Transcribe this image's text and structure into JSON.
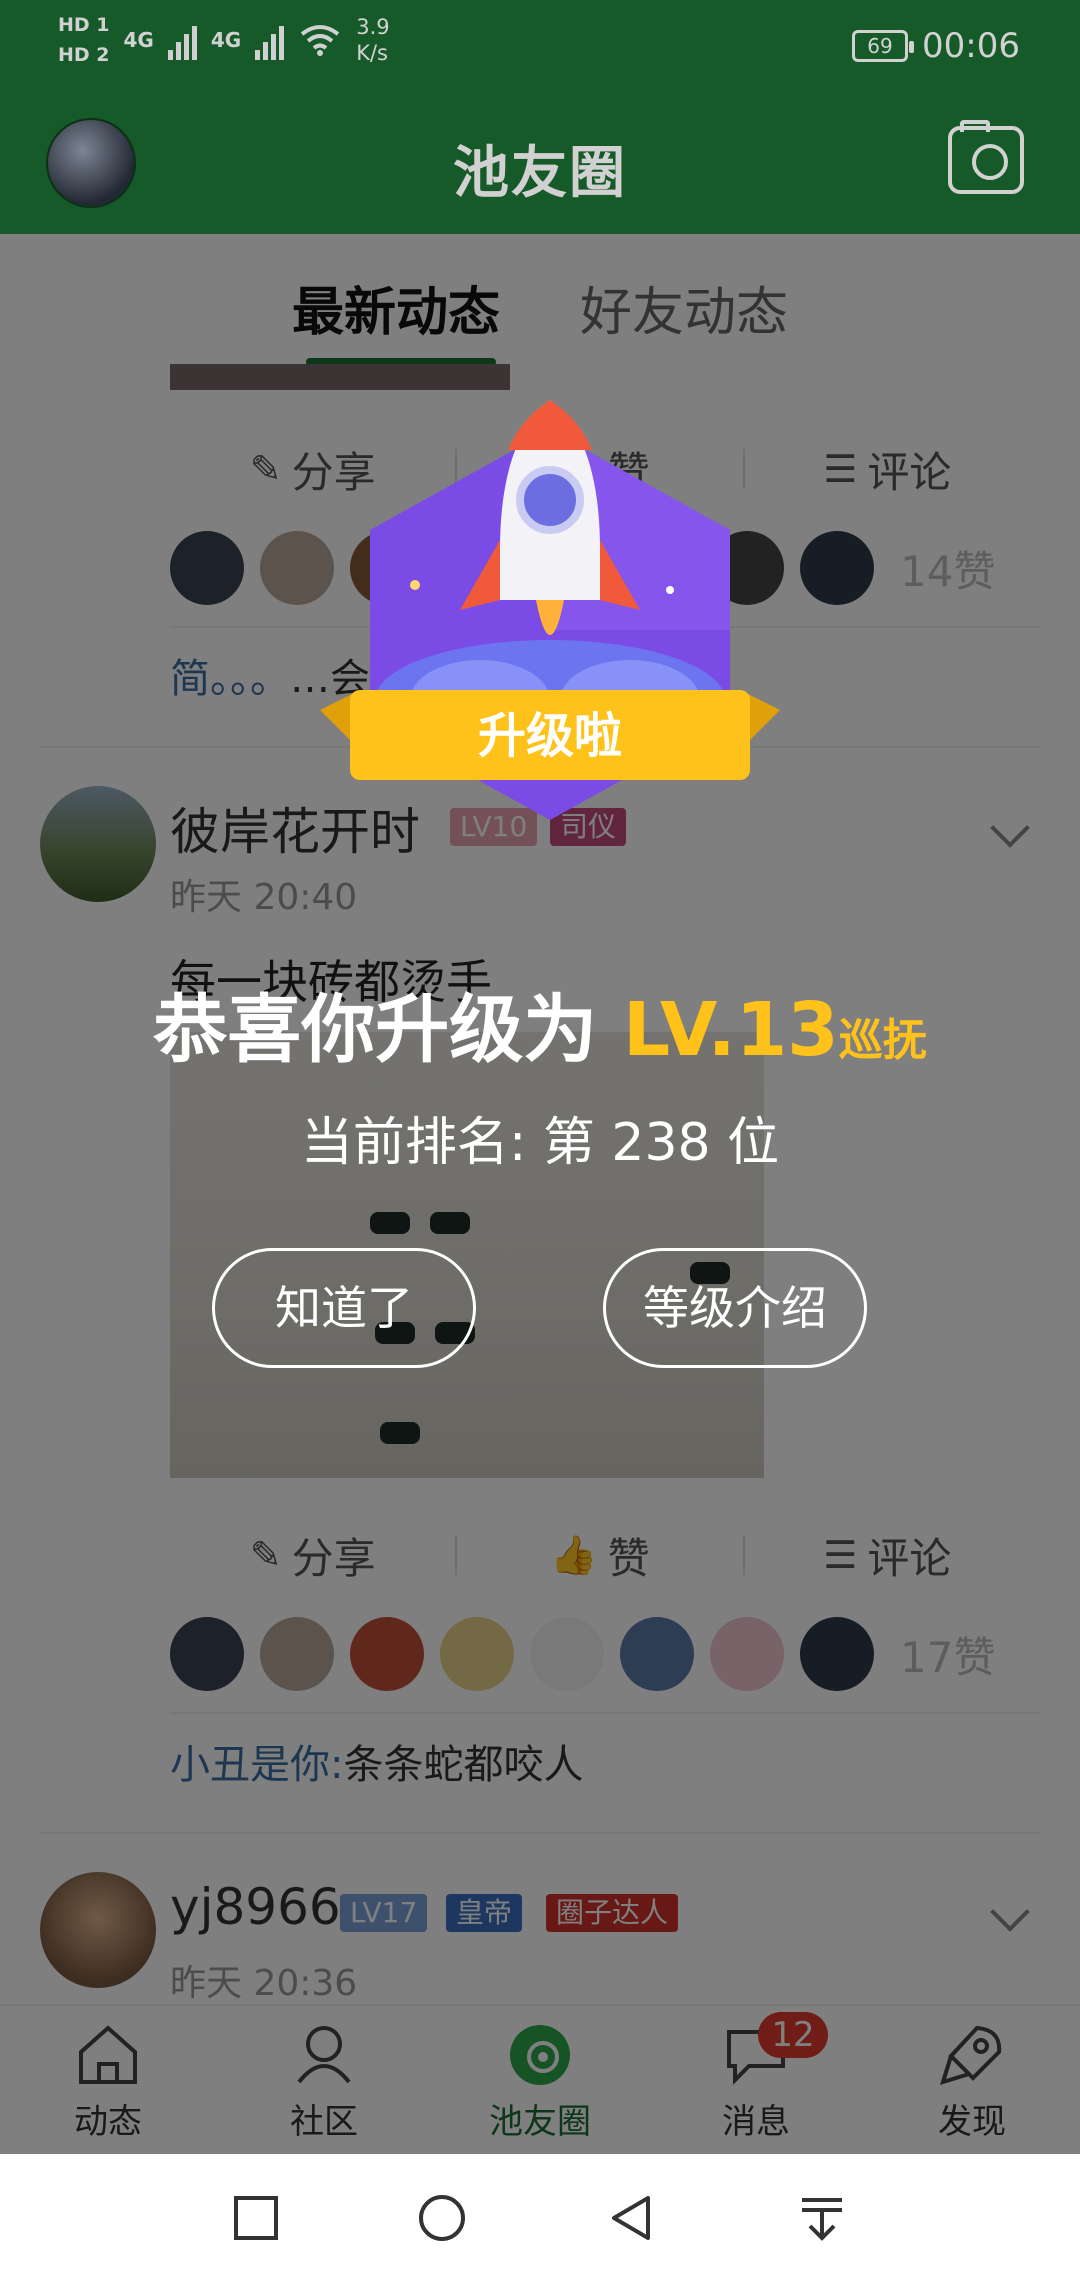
{
  "status_bar": {
    "hd1": "HD 1",
    "hd2": "HD 2",
    "net1": "4G",
    "net2": "4G",
    "speed_value": "3.9",
    "speed_unit": "K/s",
    "battery": "69",
    "time": "00:06"
  },
  "header": {
    "title": "池友圈"
  },
  "tabs": [
    {
      "label": "最新动态"
    },
    {
      "label": "好友动态"
    }
  ],
  "actions": {
    "share": "分享",
    "like": "赞",
    "comment": "评论"
  },
  "post1": {
    "like_count": "14赞",
    "comment_who": "简。。。",
    "comment_text": "…会手臂痛"
  },
  "post2": {
    "author": "彼岸花开时",
    "level": "LV10",
    "title_badge": "司仪",
    "time": "昨天 20:40",
    "text": "每一块砖都烫手",
    "like_count": "17赞",
    "comment_who": "小丑是你:",
    "comment_text": "条条蛇都咬人"
  },
  "post3": {
    "author": "yj8966",
    "level": "LV17",
    "title_badge": "皇帝",
    "extra_badge": "圈子达人",
    "time": "昨天 20:36"
  },
  "bottom_nav": [
    {
      "label": "动态",
      "icon": "home-icon"
    },
    {
      "label": "社区",
      "icon": "community-icon"
    },
    {
      "label": "池友圈",
      "icon": "circle-icon"
    },
    {
      "label": "消息",
      "icon": "message-icon",
      "badge": "12"
    },
    {
      "label": "发现",
      "icon": "rocket-icon"
    }
  ],
  "dialog": {
    "badge_text": "升级啦",
    "congrats_prefix": "恭喜你升级为 ",
    "level": "LV.13",
    "level_title": "巡抚",
    "rank": "当前排名: 第 238 位",
    "ok_button": "知道了",
    "level_intro_button": "等级介绍"
  },
  "colors": {
    "brand_green": "#1b6e33",
    "accent_gold": "#ffc21a",
    "badge_red": "#e23a2e"
  }
}
